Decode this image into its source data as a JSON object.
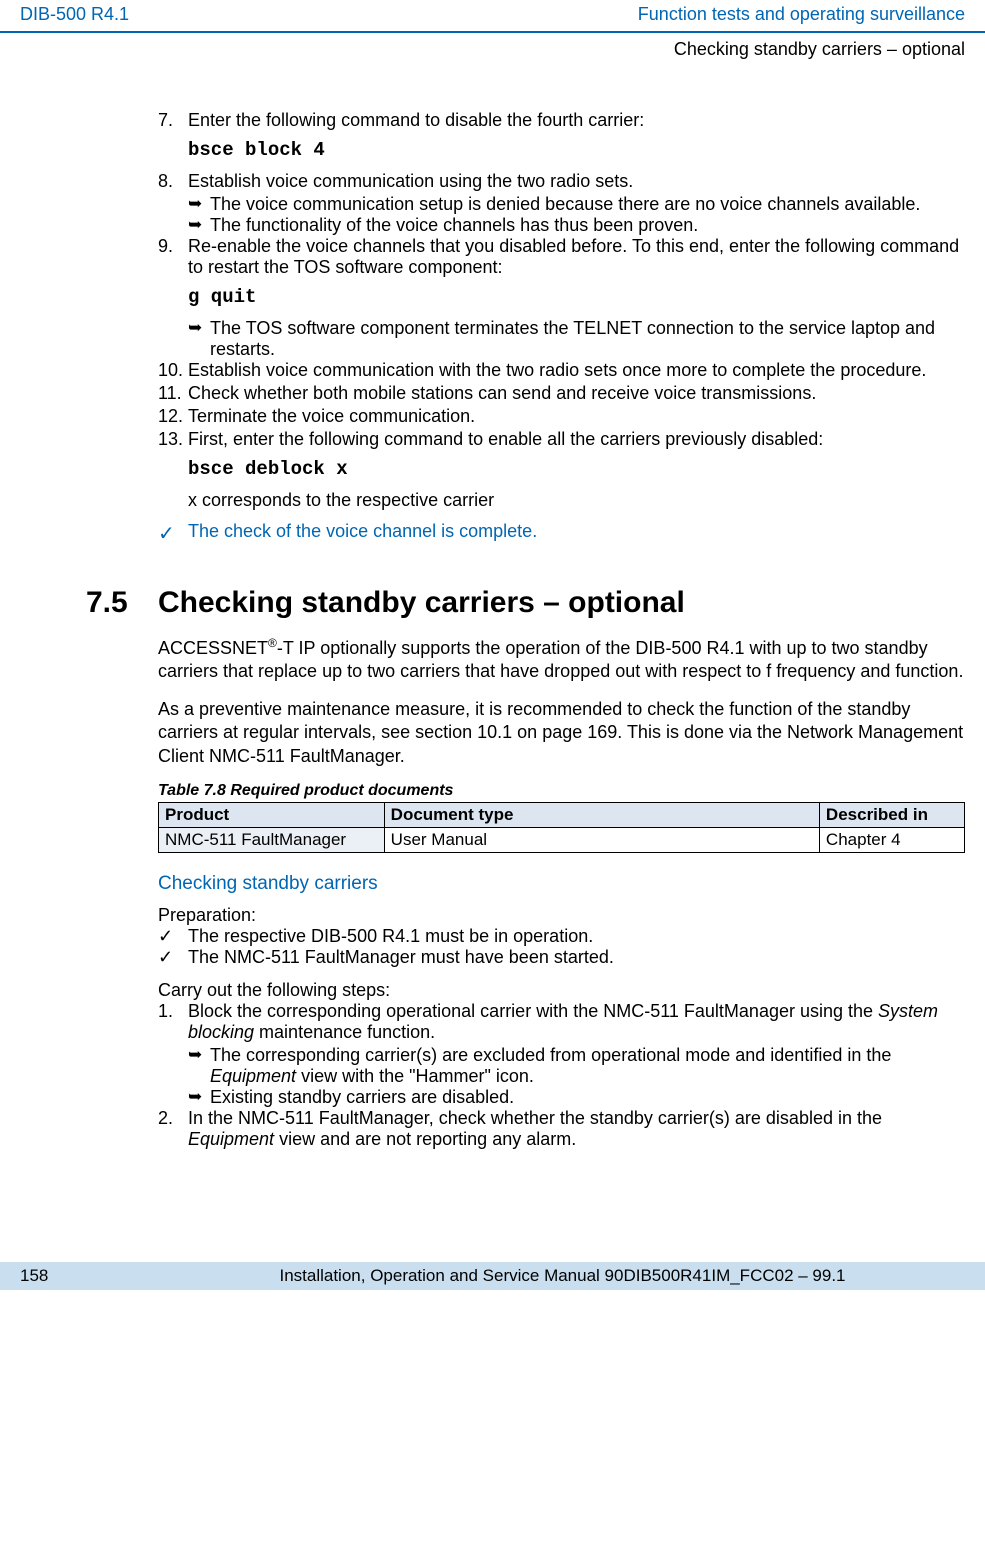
{
  "header": {
    "left": "DIB-500 R4.1",
    "right": "Function tests and operating surveillance",
    "sub": "Checking standby carriers – optional"
  },
  "body": {
    "step7": {
      "num": "7.",
      "text": "Enter the following command to disable the fourth carrier:"
    },
    "code1": "bsce  block  4",
    "step8": {
      "num": "8.",
      "text": "Establish voice communication using the two radio sets."
    },
    "step8a": "The voice communication setup is denied because there are no voice channels available.",
    "step8b": "The functionality of the voice channels has thus been proven.",
    "step9": {
      "num": "9.",
      "text": "Re-enable the voice channels that you disabled before. To this end, enter the following command to restart the TOS software component:"
    },
    "code2": "g quit",
    "step9a": "The TOS software component terminates the TELNET connection to the service laptop and restarts.",
    "step10": {
      "num": "10.",
      "text": "Establish voice communication with the two radio sets once more to complete the procedure."
    },
    "step11": {
      "num": "11.",
      "text": "Check whether both mobile stations can send and receive voice transmissions."
    },
    "step12": {
      "num": "12.",
      "text": "Terminate the voice communication."
    },
    "step13": {
      "num": "13.",
      "text": "First, enter the following command to enable all the carriers previously disabled:"
    },
    "code3": "bsce deblock x",
    "step13note": "x corresponds to the respective carrier",
    "checkComplete": "The check of the voice channel is complete.",
    "section": {
      "num": "7.5",
      "title": "Checking standby carriers – optional"
    },
    "para1a": "ACCESSNET",
    "para1b": "-T IP optionally supports the operation of the DIB-500 R4.1 with up to two standby carriers that replace up to two carriers that have dropped out with respect to f frequency and function.",
    "para2": "As a preventive maintenance measure, it is recommended to check the function of the standby carriers at regular intervals, see section 10.1 on page 169. This is done via the Network Management Client NMC-511 FaultManager.",
    "tableCaption": "Table 7.8     Required product documents",
    "table": {
      "h1": "Product",
      "h2": "Document type",
      "h3": "Described in",
      "r1c1": "NMC-511 FaultManager",
      "r1c2": "User Manual",
      "r1c3": "Chapter 4"
    },
    "subhead": "Checking standby carriers",
    "prep": "Preparation:",
    "prep1": "The respective DIB-500 R4.1 must be in operation.",
    "prep2": "The NMC-511 FaultManager must have been started.",
    "carry": "Carry out the following steps:",
    "c1": {
      "num": "1.",
      "pre": "Block the corresponding operational carrier with the NMC-511 FaultManager using the ",
      "em": "System blocking",
      "post": " maintenance function."
    },
    "c1a_pre": "The corresponding carrier(s) are excluded from operational mode and identified in the ",
    "c1a_em": "Equipment",
    "c1a_post": " view with the \"Hammer\" icon.",
    "c1b": "Existing standby carriers are disabled.",
    "c2": {
      "num": "2.",
      "pre": "In the NMC-511 FaultManager, check whether the standby carrier(s) are disabled in the ",
      "em": "Equipment",
      "post": " view and are not reporting any alarm."
    }
  },
  "footer": {
    "page": "158",
    "text": "Installation, Operation and Service Manual 90DIB500R41IM_FCC02  –  99.1"
  }
}
